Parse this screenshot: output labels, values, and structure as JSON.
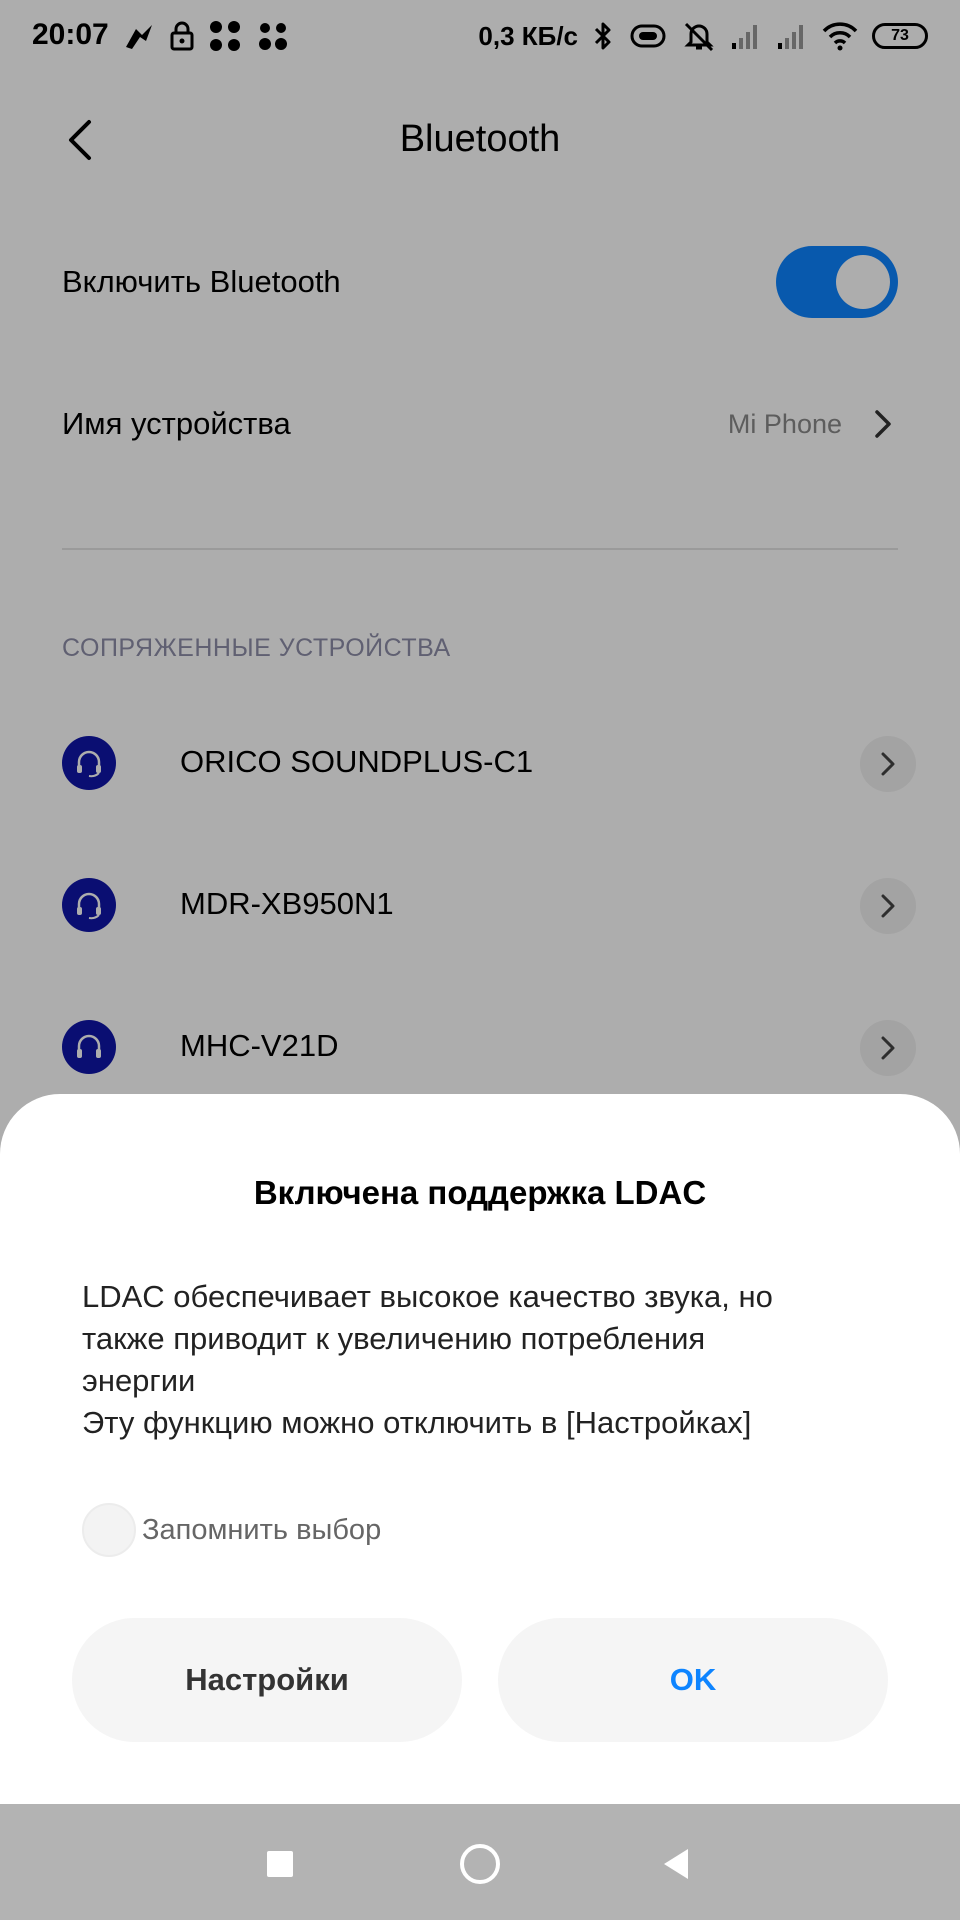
{
  "status_bar": {
    "time": "20:07",
    "network_speed": "0,3 КБ/с",
    "battery_level": "73",
    "icons": [
      "quickapp-icon",
      "lock-icon",
      "app-dots-icon",
      "app-dots-icon",
      "bluetooth-icon",
      "vibrate-icon",
      "alarm-off-icon",
      "signal-icon",
      "signal-icon",
      "wifi-icon",
      "battery-icon"
    ]
  },
  "header": {
    "title": "Bluetooth",
    "back_icon": "back-arrow-icon"
  },
  "bluetooth_toggle": {
    "label": "Включить Bluetooth",
    "enabled": true,
    "accent_color": "#0d84ff"
  },
  "device_name": {
    "label": "Имя устройства",
    "value": "Mi Phone"
  },
  "paired_section": {
    "title": "СОПРЯЖЕННЫЕ УСТРОЙСТВА",
    "devices": [
      {
        "name": "ORICO SOUNDPLUS-C1",
        "icon": "headset-icon"
      },
      {
        "name": "MDR-XB950N1",
        "icon": "headset-icon"
      },
      {
        "name": "MHC-V21D",
        "icon": "headphones-icon"
      }
    ]
  },
  "dialog": {
    "title": "Включена поддержка LDAC",
    "message_lines": [
      "LDAC обеспечивает высокое качество звука, но",
      "также приводит к увеличению потребления",
      "энергии",
      "Эту функцию можно отключить в [Настройках]"
    ],
    "remember_label": "Запомнить выбор",
    "remember_checked": false,
    "buttons": {
      "settings": "Настройки",
      "ok": "OK"
    }
  },
  "navigation": {
    "icons": [
      "recents-square-icon",
      "home-circle-icon",
      "back-triangle-icon"
    ]
  }
}
